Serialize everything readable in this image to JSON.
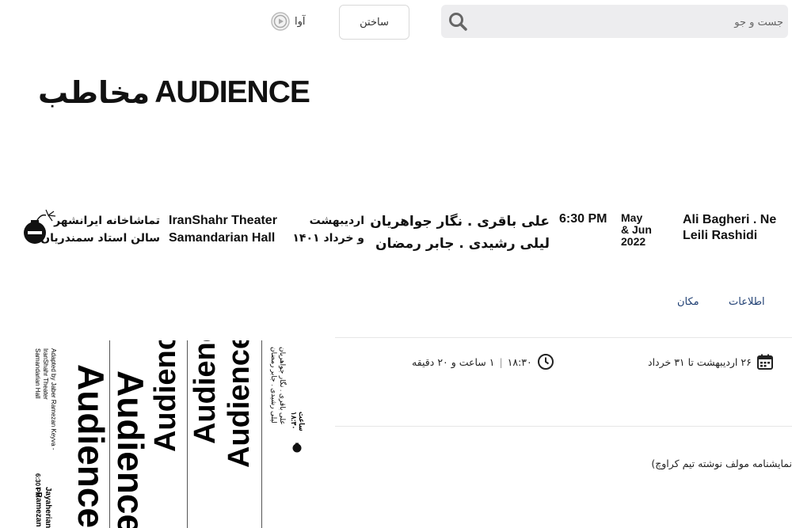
{
  "header": {
    "search_placeholder": "جست و جو",
    "build_label": "ساختن",
    "avaa_label": "آوا"
  },
  "logo": {
    "fa": "مخاطب",
    "en": "AUDIENCE"
  },
  "banner": {
    "venue_fa": [
      "تماشاخانه ایرانشهر",
      "سالن استاد سمندریان"
    ],
    "venue_en": [
      "IranShahr Theater",
      "Samandarian Hall"
    ],
    "date_fa": [
      "اردیبهشت",
      "و خرداد ۱۴۰۱"
    ],
    "cast_fa": [
      "علی باقری . نگار جواهریان",
      "لیلی رشیدی . جابر رمضان"
    ],
    "time_en": "6:30 PM",
    "month_en": [
      "May",
      "& Jun",
      "2022"
    ],
    "cast_en": [
      "Ali Bagheri . Ne",
      "Leili Rashidi"
    ]
  },
  "tabs": {
    "info": "اطلاعات",
    "location": "مکان"
  },
  "info": {
    "date_range": "۲۶ اردیبهشت تا ۳۱ خرداد",
    "time": "۱۸:۳۰",
    "separator": "|",
    "duration": "۱ ساعت و ۲۰ دقیقه",
    "description": "نمایشنامه مولف نوشته تیم کراوچ)"
  },
  "poster": {
    "big_word": "Audience",
    "credits_en": [
      "Adapted by Jaber Ramezan  Keyva -",
      "IranShahr Theater",
      "Samandarian Hall"
    ],
    "time_en": "6:30 PM",
    "names_en": [
      "Jayaherian",
      "r Ramezan"
    ],
    "cast_fa": [
      "علی باقری . نگار جواهریان",
      "لیلی رشیدی . جابر رمضان"
    ],
    "time_fa": [
      "ساعت",
      "۱۸:۳۰"
    ]
  },
  "colors": {
    "tab_text": "#1f3f73",
    "search_bg": "#ededef"
  }
}
